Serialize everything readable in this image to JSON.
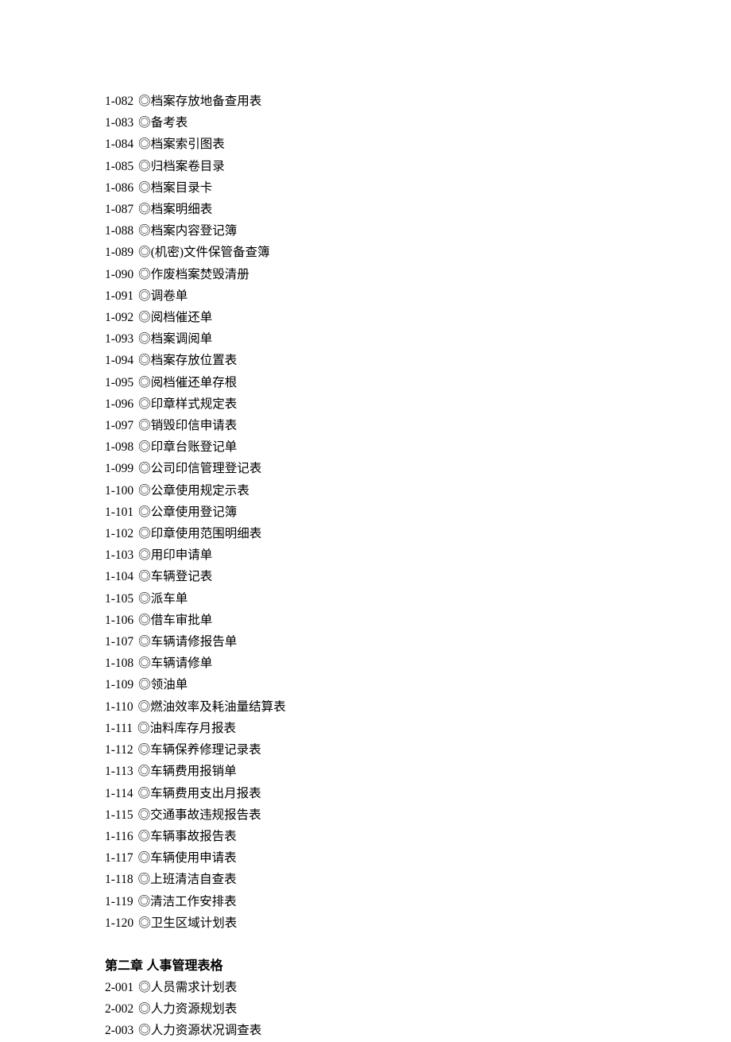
{
  "bullet": "◎",
  "sections": [
    {
      "type": "list",
      "items": [
        {
          "code": "1-082",
          "title": "档案存放地备查用表"
        },
        {
          "code": "1-083",
          "title": "备考表"
        },
        {
          "code": "1-084",
          "title": "档案索引图表"
        },
        {
          "code": "1-085",
          "title": "归档案卷目录"
        },
        {
          "code": "1-086",
          "title": "档案目录卡"
        },
        {
          "code": "1-087",
          "title": "档案明细表"
        },
        {
          "code": "1-088",
          "title": "档案内容登记簿"
        },
        {
          "code": "1-089",
          "title": "(机密)文件保管备查簿"
        },
        {
          "code": "1-090",
          "title": "作废档案焚毁清册"
        },
        {
          "code": "1-091",
          "title": "调卷单"
        },
        {
          "code": "1-092",
          "title": "阅档催还单"
        },
        {
          "code": "1-093",
          "title": "档案调阅单"
        },
        {
          "code": "1-094",
          "title": "档案存放位置表"
        },
        {
          "code": "1-095",
          "title": "阅档催还单存根"
        },
        {
          "code": "1-096",
          "title": "印章样式规定表"
        },
        {
          "code": "1-097",
          "title": "销毁印信申请表"
        },
        {
          "code": "1-098",
          "title": "印章台账登记单"
        },
        {
          "code": "1-099",
          "title": "公司印信管理登记表"
        },
        {
          "code": "1-100",
          "title": "公章使用规定示表"
        },
        {
          "code": "1-101",
          "title": "公章使用登记簿"
        },
        {
          "code": "1-102",
          "title": "印章使用范围明细表"
        },
        {
          "code": "1-103",
          "title": "用印申请单"
        },
        {
          "code": "1-104",
          "title": "车辆登记表"
        },
        {
          "code": "1-105",
          "title": "派车单"
        },
        {
          "code": "1-106",
          "title": "借车审批单"
        },
        {
          "code": "1-107",
          "title": "车辆请修报告单"
        },
        {
          "code": "1-108",
          "title": "车辆请修单"
        },
        {
          "code": "1-109",
          "title": "领油单"
        },
        {
          "code": "1-110",
          "title": "燃油效率及耗油量结算表"
        },
        {
          "code": "1-111",
          "title": "油料库存月报表"
        },
        {
          "code": "1-112",
          "title": "车辆保养修理记录表"
        },
        {
          "code": "1-113",
          "title": "车辆费用报销单"
        },
        {
          "code": "1-114",
          "title": "车辆费用支出月报表"
        },
        {
          "code": "1-115",
          "title": "交通事故违规报告表"
        },
        {
          "code": "1-116",
          "title": "车辆事故报告表"
        },
        {
          "code": "1-117",
          "title": "车辆使用申请表"
        },
        {
          "code": "1-118",
          "title": "上班清洁自查表"
        },
        {
          "code": "1-119",
          "title": "清洁工作安排表"
        },
        {
          "code": "1-120",
          "title": "卫生区域计划表"
        }
      ]
    },
    {
      "type": "heading",
      "prefix": "第二章",
      "title": "人事管理表格"
    },
    {
      "type": "list",
      "items": [
        {
          "code": "2-001",
          "title": "人员需求计划表"
        },
        {
          "code": "2-002",
          "title": "人力资源规划表"
        },
        {
          "code": "2-003",
          "title": "人力资源状况调查表"
        }
      ]
    }
  ]
}
